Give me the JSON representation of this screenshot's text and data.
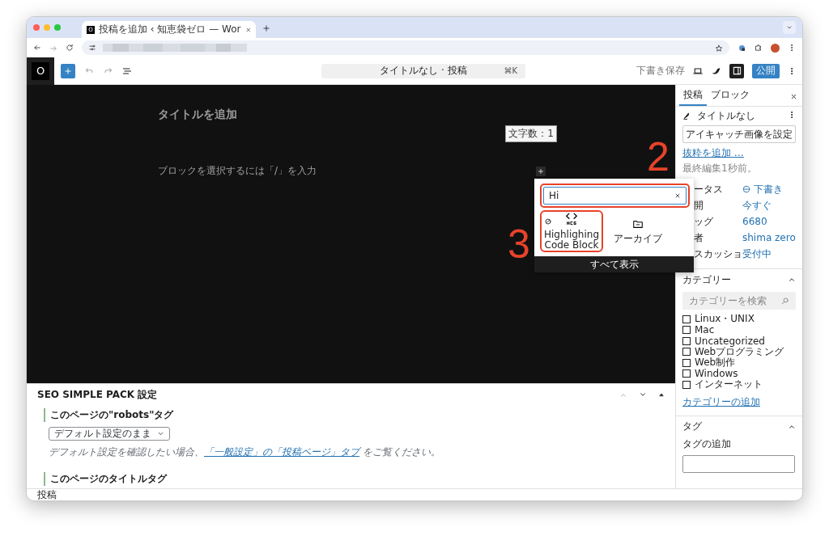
{
  "browser": {
    "tab_title": "投稿を追加 ‹ 知恵袋ゼロ — Wor",
    "tab_favicon": "O"
  },
  "toolbar": {
    "site_icon": "O",
    "command_title": "タイトルなし · 投稿",
    "command_shortcut": "⌘K",
    "save_draft": "下書き保存",
    "settings_on": true,
    "publish": "公開"
  },
  "editor": {
    "title_placeholder": "タイトルを追加",
    "word_count": "文字数：1",
    "paragraph_placeholder": "ブロックを選択するには「/」を入力"
  },
  "inserter": {
    "search_value": "Hi",
    "search_highlighted": true,
    "results": [
      {
        "label": "Highlighing Code Block",
        "kind": "hcb",
        "highlighted": true
      },
      {
        "label": "アーカイブ",
        "kind": "archive",
        "highlighted": false
      }
    ],
    "show_all": "すべて表示"
  },
  "annotations": [
    {
      "label": "2"
    },
    {
      "label": "3"
    }
  ],
  "sidebar": {
    "tabs": [
      {
        "label": "投稿",
        "selected": true
      },
      {
        "label": "ブロック",
        "selected": false
      }
    ],
    "post_title": "タイトルなし",
    "featured_image_button": "アイキャッチ画像を設定",
    "excerpt_link": "抜粋を追加 …",
    "last_edited": "最終編集1秒前。",
    "rows": [
      {
        "label": "ータス",
        "value": "下書き",
        "kind": "status"
      },
      {
        "label": "開",
        "value": "今すぐ",
        "kind": "link"
      },
      {
        "label": "ッグ",
        "value": "6680",
        "kind": "link"
      },
      {
        "label": "者",
        "value": "shima zero",
        "kind": "link"
      },
      {
        "label": "スカッショ",
        "value": "受付中",
        "kind": "link"
      }
    ],
    "categories_panel": {
      "title": "カテゴリー",
      "expanded": true,
      "search_placeholder": "カテゴリーを検索",
      "items": [
        {
          "label": "Linux・UNIX",
          "checked": false
        },
        {
          "label": "Mac",
          "checked": false
        },
        {
          "label": "Uncategorized",
          "checked": false
        },
        {
          "label": "Webプログラミング",
          "checked": false
        },
        {
          "label": "Web制作",
          "checked": false
        },
        {
          "label": "Windows",
          "checked": false
        },
        {
          "label": "インターネット",
          "checked": false
        }
      ],
      "add_link": "カテゴリーの追加"
    },
    "tags_panel": {
      "title": "タグ",
      "expanded": true,
      "field_label": "タグの追加"
    }
  },
  "seo_panel": {
    "title": "SEO SIMPLE PACK 設定",
    "robots_heading": "このページの\"robots\"タグ",
    "robots_select": "デフォルト設定のまま",
    "help_before": "デフォルト設定を確認したい場合、",
    "help_link": "「一般設定」の「投稿ページ」タブ",
    "help_after": " をご覧ください。",
    "title_heading": "このページのタイトルタグ"
  },
  "status_bar": "投稿"
}
